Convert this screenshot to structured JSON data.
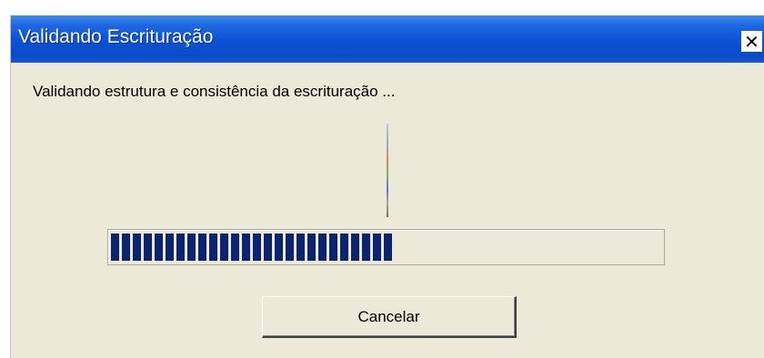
{
  "window": {
    "title": "Validando Escrituração",
    "close_icon": "close-icon",
    "titlebar_color": "#0a52d6",
    "background_color": "#ece9d8"
  },
  "dialog": {
    "message": "Validando estrutura e consistência da escrituração ...",
    "progress_percent": 51,
    "progress_color": "#0a2470",
    "cancel_label": "Cancelar"
  }
}
